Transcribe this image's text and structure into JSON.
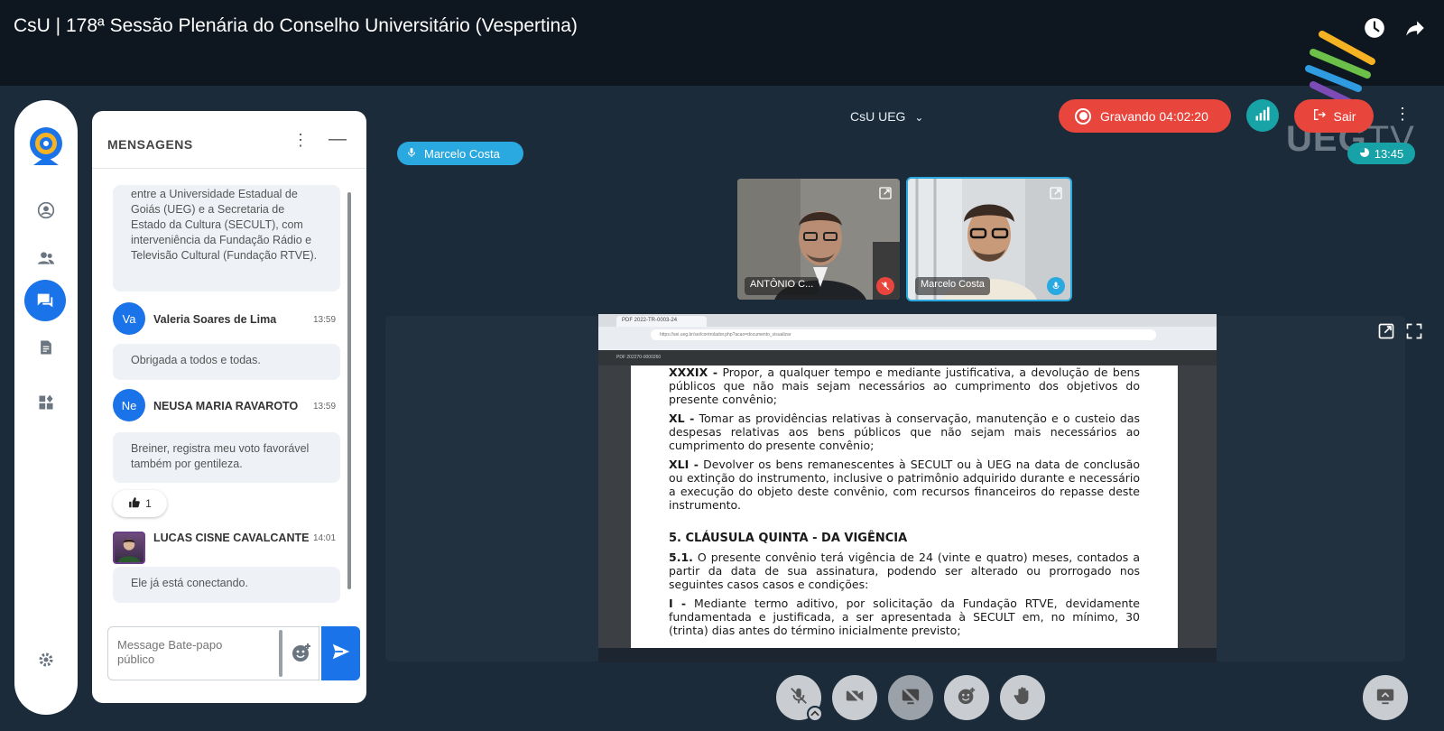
{
  "video": {
    "title": "CsU | 178ª Sessão Plenária do Conselho Universitário (Vespertina)",
    "channel_logo": "UEG TV"
  },
  "meeting": {
    "room_name": "CsU UEG",
    "recording_label": "Gravando 04:02:20",
    "exit_label": "Sair",
    "clock": "13:45",
    "active_speaker": "Marcelo Costa"
  },
  "chat": {
    "title": "MENSAGENS",
    "partial_message": "entre a Universidade Estadual de Goiás (UEG) e a Secretaria de Estado da Cultura (SECULT), com interveniência da Fundação Rádio e Televisão Cultural (Fundação RTVE).",
    "messages": [
      {
        "initials": "Va",
        "sender": "Valeria Soares de Lima",
        "time": "13:59",
        "text": "Obrigada a todos e todas."
      },
      {
        "initials": "Ne",
        "sender": "NEUSA MARIA RAVAROTO",
        "time": "13:59",
        "text": "Breiner, registra meu voto favorável também por gentileza.",
        "reaction_count": "1"
      },
      {
        "initials": "",
        "sender": "LUCAS CISNE CAVALCANTE",
        "time": "14:01",
        "text": "Ele já está conectando."
      }
    ],
    "input_placeholder": "Message Bate-papo público"
  },
  "participants": [
    {
      "name": "ANTÔNIO C...",
      "muted": true
    },
    {
      "name": "Marcelo Costa",
      "muted": false
    }
  ],
  "shared_screen": {
    "browser_tab": "PDF 2022-TR-0003-24",
    "url": "https://sei.ueg.br/sei/controlador.php?acao=documento_visualizar",
    "pdf_toolbar": "PDF 202270-0000260",
    "paragraphs": [
      {
        "label": "XXXIX -",
        "text": " Propor, a qualquer tempo e mediante justificativa, a devolução de bens públicos que não mais sejam necessários ao cumprimento dos objetivos do presente convênio;"
      },
      {
        "label": "XL -",
        "text": " Tomar as providências relativas à conservação, manutenção e o custeio das despesas relativas aos bens públicos que não sejam mais necessários ao cumprimento do presente convênio;"
      },
      {
        "label": "XLI -",
        "text": " Devolver os bens remanescentes à SECULT ou à UEG na data de conclusão ou extinção do instrumento, inclusive o patrimônio adquirido durante e necessário a execução do objeto deste convênio, com recursos financeiros do repasse deste instrumento."
      }
    ],
    "heading": "5. CLÁUSULA QUINTA - DA VIGÊNCIA",
    "clause_label": "5.1.",
    "clause_text": " O presente convênio terá vigência de 24 (vinte e quatro) meses, contados a partir da data de sua assinatura, podendo ser alterado ou prorrogado nos seguintes casos casos e condições:",
    "item_label": "I -",
    "item_text": " Mediante termo aditivo, por solicitação da Fundação RTVE, devidamente fundamentada e justificada, a ser apresentada à SECULT em, no mínimo, 30 (trinta) dias antes do término inicialmente previsto;"
  },
  "colors": {
    "background": "#1b2b3a",
    "accent_blue": "#1a73e8",
    "record_red": "#e8453c",
    "teal": "#17a2a8"
  }
}
